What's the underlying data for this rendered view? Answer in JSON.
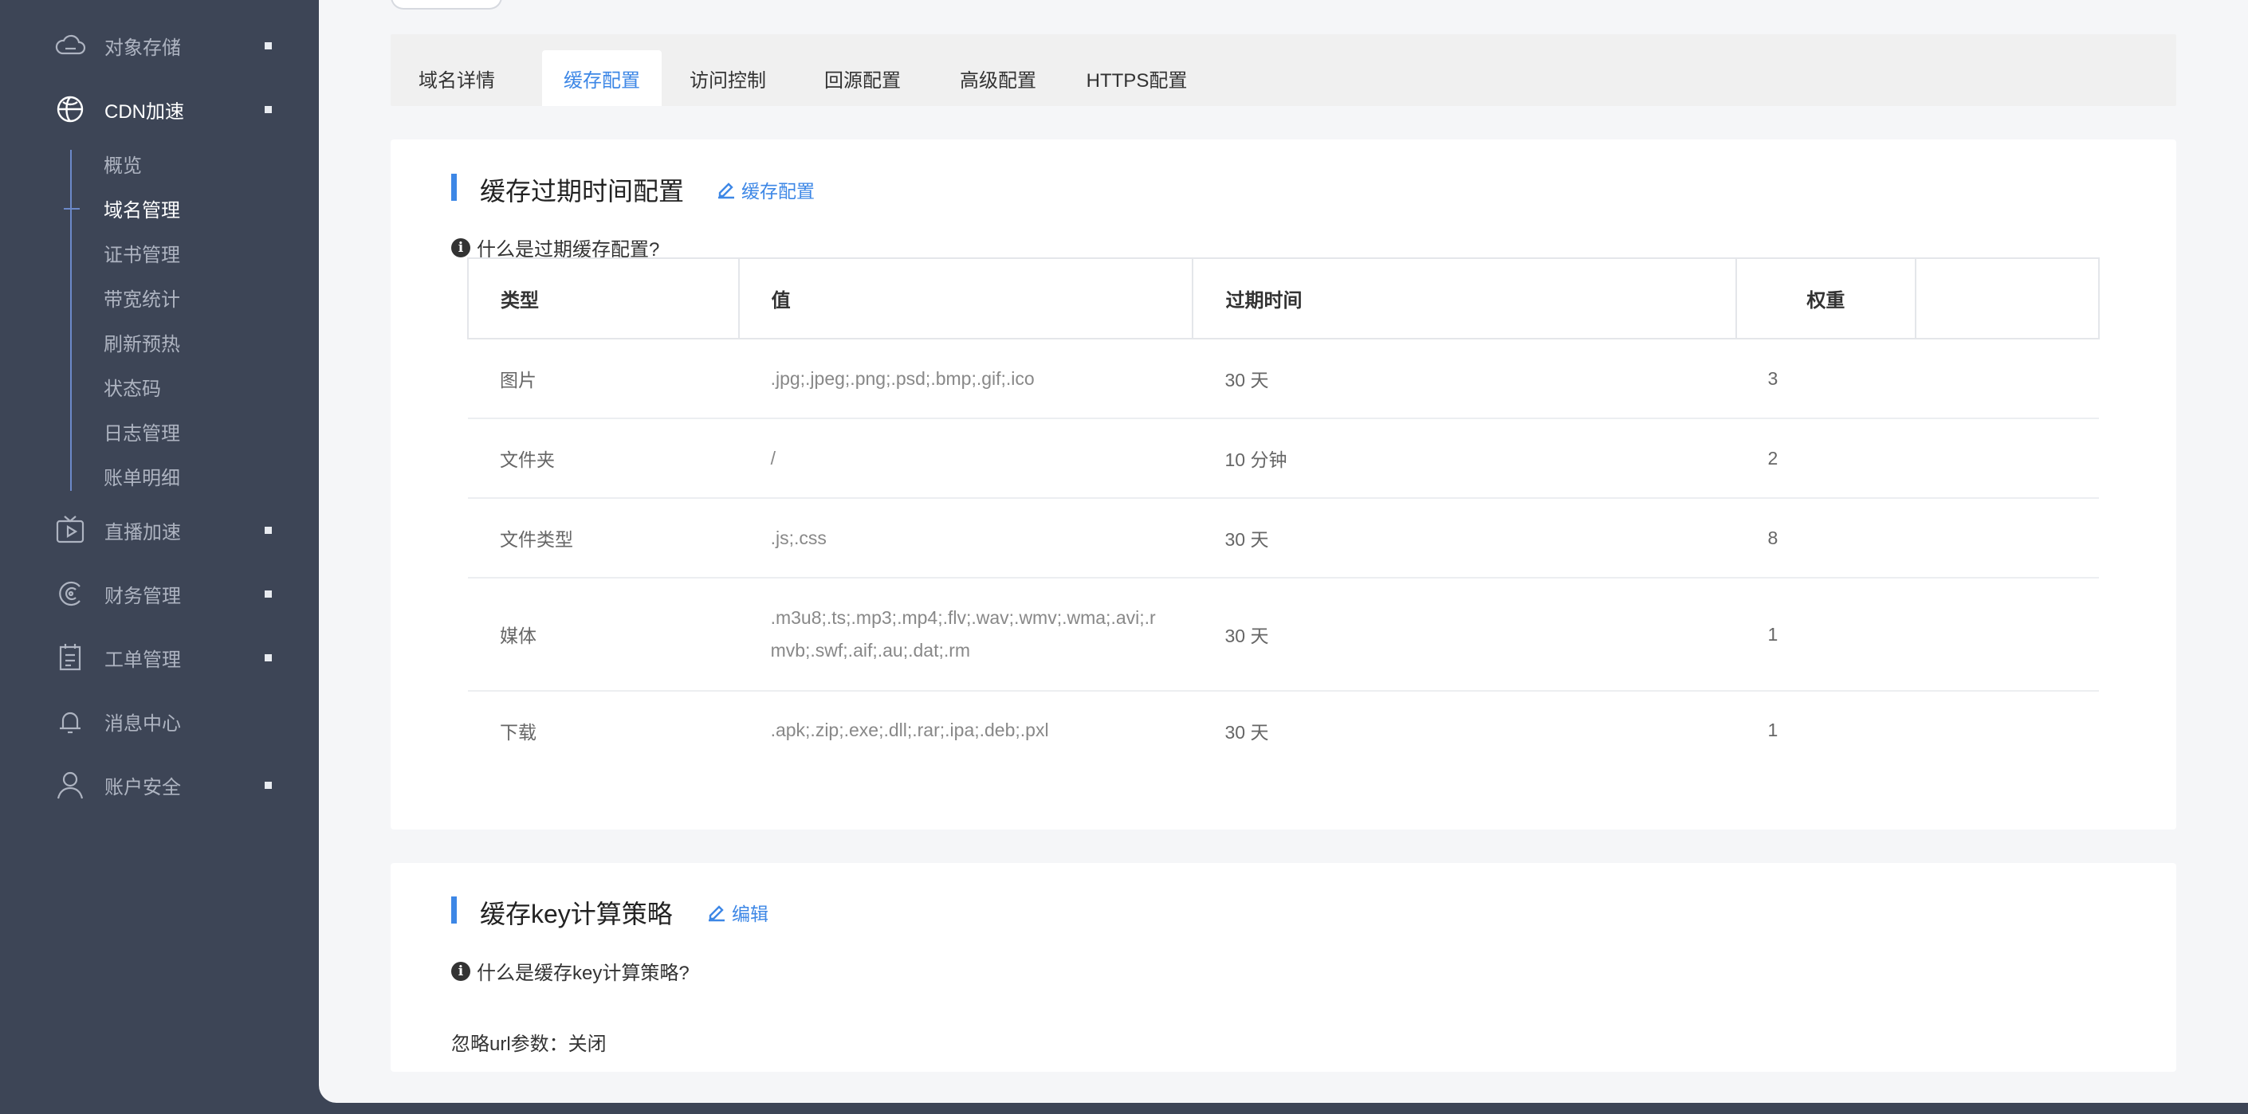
{
  "sidebar": {
    "items": [
      {
        "label": "对象存储",
        "icon": "cloud-icon",
        "has_dot": true
      },
      {
        "label": "CDN加速",
        "icon": "globe-icon",
        "has_dot": true,
        "open": true
      },
      {
        "label": "直播加速",
        "icon": "tv-play-icon",
        "has_dot": true
      },
      {
        "label": "财务管理",
        "icon": "finance-icon",
        "has_dot": true
      },
      {
        "label": "工单管理",
        "icon": "ticket-icon",
        "has_dot": true
      },
      {
        "label": "消息中心",
        "icon": "bell-icon",
        "has_dot": false
      },
      {
        "label": "账户安全",
        "icon": "user-icon",
        "has_dot": true
      }
    ],
    "cdn_submenu": [
      {
        "label": "概览"
      },
      {
        "label": "域名管理",
        "active": true
      },
      {
        "label": "证书管理"
      },
      {
        "label": "带宽统计"
      },
      {
        "label": "刷新预热"
      },
      {
        "label": "状态码"
      },
      {
        "label": "日志管理"
      },
      {
        "label": "账单明细"
      }
    ]
  },
  "tabs": [
    {
      "label": "域名详情"
    },
    {
      "label": "缓存配置",
      "active": true
    },
    {
      "label": "访问控制"
    },
    {
      "label": "回源配置"
    },
    {
      "label": "高级配置"
    },
    {
      "label": "HTTPS配置"
    }
  ],
  "cache_expiry": {
    "title": "缓存过期时间配置",
    "edit_label": "缓存配置",
    "help_text": "什么是过期缓存配置?",
    "columns": [
      "类型",
      "值",
      "过期时间",
      "权重",
      ""
    ],
    "rows": [
      {
        "type": "图片",
        "value": ".jpg;.jpeg;.png;.psd;.bmp;.gif;.ico",
        "expire": "30 天",
        "weight": "3"
      },
      {
        "type": "文件夹",
        "value": "/",
        "expire": "10 分钟",
        "weight": "2"
      },
      {
        "type": "文件类型",
        "value": ".js;.css",
        "expire": "30 天",
        "weight": "8"
      },
      {
        "type": "媒体",
        "value_line1": ".m3u8;.ts;.mp3;.mp4;.flv;.wav;.wmv;.wma;.avi;.r",
        "value_line2": "mvb;.swf;.aif;.au;.dat;.rm",
        "expire": "30 天",
        "weight": "1"
      },
      {
        "type": "下载",
        "value": ".apk;.zip;.exe;.dll;.rar;.ipa;.deb;.pxl",
        "expire": "30 天",
        "weight": "1"
      }
    ]
  },
  "cache_key": {
    "title": "缓存key计算策略",
    "edit_label": "编辑",
    "help_text": "什么是缓存key计算策略?",
    "ignore_label": "忽略url参数：",
    "ignore_value": "关闭"
  },
  "colors": {
    "accent": "#3d87e6",
    "sidebar_bg": "#3d4556",
    "page_bg": "#f5f6f8"
  }
}
